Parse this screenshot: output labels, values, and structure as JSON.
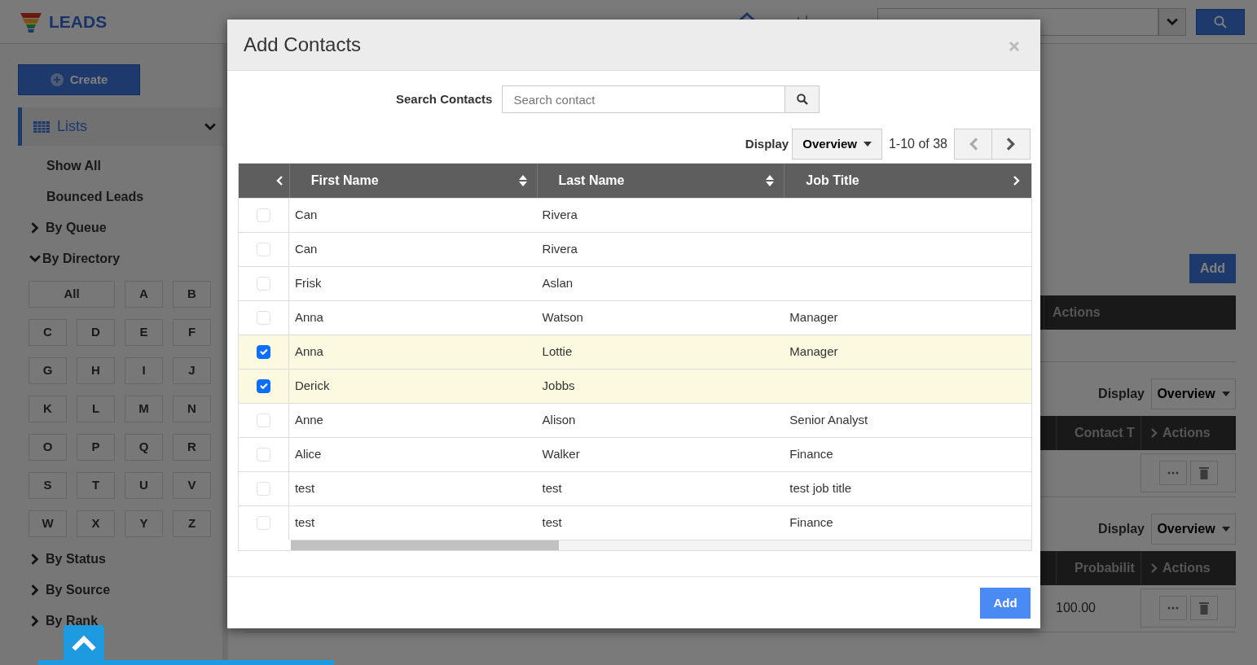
{
  "app": {
    "title": "LEADS"
  },
  "sidebar": {
    "create_label": "Create",
    "lists_label": "Lists",
    "lists_expanded": true,
    "items": [
      {
        "label": "Show All",
        "kind": "link"
      },
      {
        "label": "Bounced Leads",
        "kind": "link"
      },
      {
        "label": "By Queue",
        "kind": "group",
        "expanded": false
      },
      {
        "label": "By Directory",
        "kind": "group",
        "expanded": true,
        "letters": [
          "All",
          "A",
          "B",
          "C",
          "D",
          "E",
          "F",
          "G",
          "H",
          "I",
          "J",
          "K",
          "L",
          "M",
          "N",
          "O",
          "P",
          "Q",
          "R",
          "S",
          "T",
          "U",
          "V",
          "W",
          "X",
          "Y",
          "Z"
        ]
      },
      {
        "label": "By Status",
        "kind": "group",
        "expanded": false
      },
      {
        "label": "By Source",
        "kind": "group",
        "expanded": false
      },
      {
        "label": "By Rank",
        "kind": "group",
        "expanded": false
      }
    ]
  },
  "main": {
    "add_label": "Add",
    "panels": [
      {
        "columns": [
          "Actions"
        ]
      },
      {
        "display_label": "Display",
        "display_value": "Overview",
        "columns": [
          "Contact T",
          "Actions"
        ],
        "rows": [
          {
            "actions": true
          }
        ]
      },
      {
        "display_label": "Display",
        "display_value": "Overview",
        "columns": [
          "Probabilit",
          "Actions"
        ],
        "rows": [
          {
            "cells": [
              "100.00"
            ],
            "actions": true
          }
        ]
      }
    ]
  },
  "modal": {
    "title": "Add Contacts",
    "search_label": "Search Contacts",
    "search_placeholder": "Search contact",
    "display_label": "Display",
    "display_value": "Overview",
    "range": "1-10 of 38",
    "columns": [
      "First Name",
      "Last Name",
      "Job Title"
    ],
    "rows": [
      {
        "selected": false,
        "first_name": "Can",
        "last_name": "Rivera"
      },
      {
        "selected": false,
        "first_name": "Can",
        "last_name": "Rivera"
      },
      {
        "selected": false,
        "first_name": "Frisk",
        "last_name": "Aslan"
      },
      {
        "selected": false,
        "first_name": "Anna",
        "last_name": "Watson",
        "job_title": "Manager"
      },
      {
        "selected": true,
        "first_name": "Anna",
        "last_name": "Lottie",
        "job_title": "Manager"
      },
      {
        "selected": true,
        "first_name": "Derick",
        "last_name": "Jobbs"
      },
      {
        "selected": false,
        "first_name": "Anne",
        "last_name": "Alison",
        "job_title": "Senior Analyst"
      },
      {
        "selected": false,
        "first_name": "Alice",
        "last_name": "Walker",
        "job_title": "Finance"
      },
      {
        "selected": false,
        "first_name": "test",
        "last_name": "test",
        "job_title": "test job title"
      },
      {
        "selected": false,
        "first_name": "test",
        "last_name": "test",
        "job_title": "Finance"
      }
    ],
    "add_label": "Add"
  }
}
